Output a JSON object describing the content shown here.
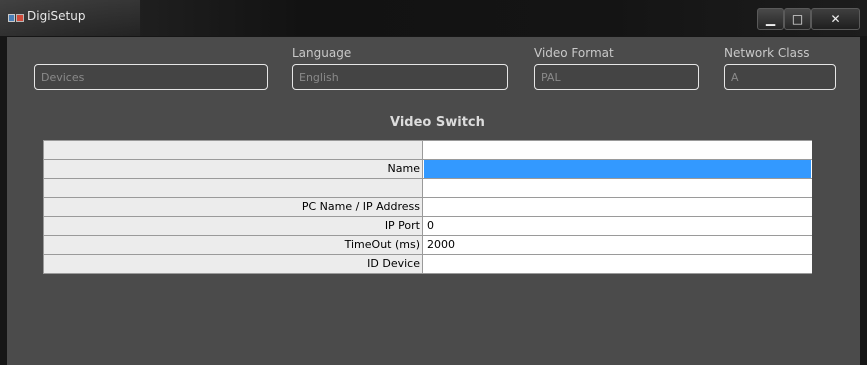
{
  "window": {
    "title": "DigiSetup",
    "controls": {
      "minimize": "▁",
      "maximize": "□",
      "close": "✕"
    }
  },
  "fields": [
    {
      "label": "",
      "value": "Devices"
    },
    {
      "label": "Language",
      "value": "English"
    },
    {
      "label": "Video Format",
      "value": "PAL"
    },
    {
      "label": "Network Class",
      "value": "A"
    }
  ],
  "section": {
    "title": "Video Switch"
  },
  "properties": [
    {
      "label": "",
      "value": ""
    },
    {
      "label": "Name",
      "value": "",
      "selected": true
    },
    {
      "label": "",
      "value": ""
    },
    {
      "label": "PC Name / IP Address",
      "value": ""
    },
    {
      "label": "IP Port",
      "value": "0"
    },
    {
      "label": "TimeOut (ms)",
      "value": "2000"
    },
    {
      "label": "ID Device",
      "value": ""
    }
  ],
  "colors": {
    "selection": "#3399ff",
    "panel": "#4b4b4b",
    "titlebar": "#141414"
  }
}
